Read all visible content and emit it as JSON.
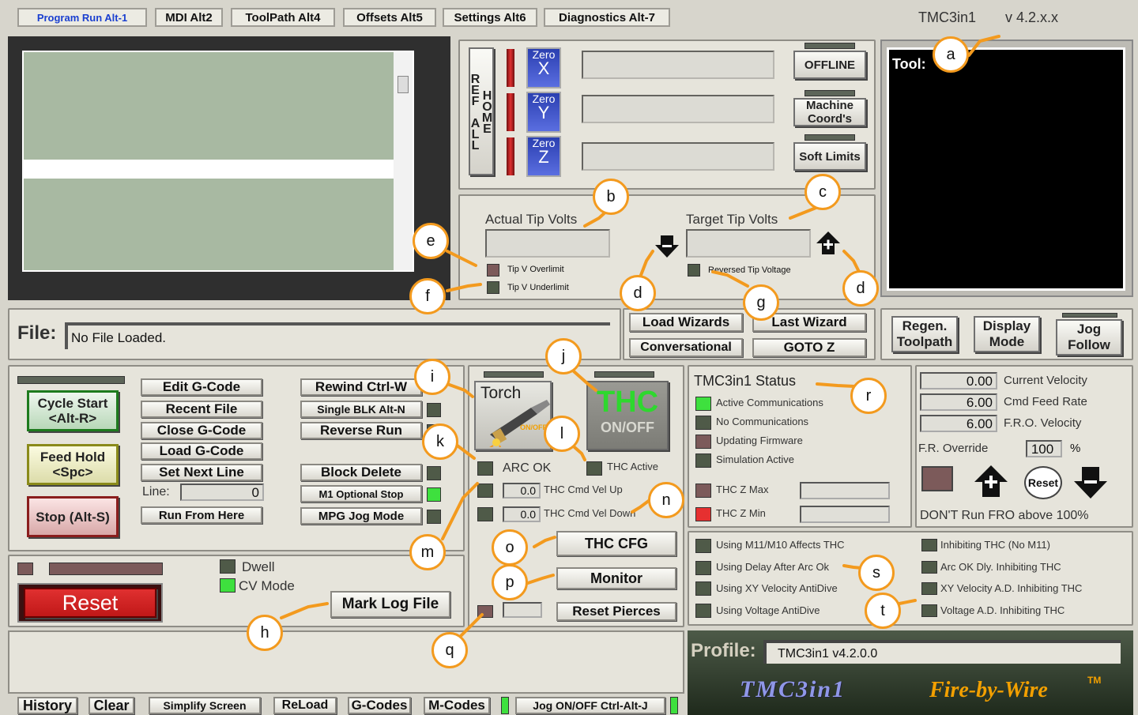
{
  "tabs": [
    "Program Run Alt-1",
    "MDI Alt2",
    "ToolPath Alt4",
    "Offsets Alt5",
    "Settings Alt6",
    "Diagnostics Alt-7"
  ],
  "header": {
    "app": "TMC3in1",
    "version": "v 4.2.x.x"
  },
  "dro": {
    "ref_all_home": "REF ALL HOME",
    "zero_label": "Zero",
    "axes": [
      "X",
      "Y",
      "Z"
    ],
    "offline": "OFFLINE",
    "machine_coords": "Machine Coord's",
    "soft_limits": "Soft Limits"
  },
  "tool_label": "Tool:",
  "volts": {
    "actual": "Actual Tip Volts",
    "target": "Target Tip Volts",
    "overlimit": "Tip V Overlimit",
    "underlimit": "Tip V Underlimit",
    "reversed": "Reversed Tip Voltage"
  },
  "file": {
    "label": "File:",
    "value": "No File Loaded."
  },
  "wizards": {
    "load": "Load Wizards",
    "last": "Last Wizard",
    "conversational": "Conversational",
    "goto_z": "GOTO Z"
  },
  "view": {
    "regen": "Regen. Toolpath",
    "display": "Display Mode",
    "jog": "Jog Follow"
  },
  "run": {
    "cycle_start": "Cycle Start <Alt-R>",
    "feed_hold": "Feed Hold <Spc>",
    "stop": "Stop (Alt-S)",
    "edit": "Edit G-Code",
    "recent": "Recent File",
    "close": "Close G-Code",
    "load": "Load G-Code",
    "set_next": "Set Next Line",
    "line_label": "Line:",
    "line_value": "0",
    "run_from_here": "Run From Here",
    "rewind": "Rewind Ctrl-W",
    "single_blk": "Single BLK Alt-N",
    "reverse": "Reverse Run",
    "block_delete": "Block Delete",
    "m1_stop": "M1 Optional Stop",
    "mpg": "MPG Jog Mode"
  },
  "bottom_left": {
    "dwell": "Dwell",
    "cv_mode": "CV Mode",
    "reset": "Reset",
    "mark_log": "Mark Log File"
  },
  "thc": {
    "torch": "Torch",
    "torch_onoff": "ON/OFF",
    "thc": "THC",
    "thc_onoff": "ON/OFF",
    "arc_ok": "ARC OK",
    "thc_active": "THC Active",
    "vel_up_value": "0.0",
    "vel_up": "THC Cmd Vel Up",
    "vel_down_value": "0.0",
    "vel_down": "THC Cmd Vel Down",
    "cfg": "THC CFG",
    "monitor": "Monitor",
    "reset_pierces": "Reset Pierces"
  },
  "status": {
    "title": "TMC3in1 Status",
    "items": [
      "Active Communications",
      "No Communications",
      "Updating Firmware",
      "Simulation Active"
    ],
    "zmax": "THC Z Max",
    "zmin": "THC Z Min"
  },
  "feed": {
    "rows": [
      {
        "value": "0.00",
        "label": "Current Velocity"
      },
      {
        "value": "6.00",
        "label": "Cmd Feed Rate"
      },
      {
        "value": "6.00",
        "label": "F.R.O. Velocity"
      }
    ],
    "override_label": "F.R. Override",
    "override_value": "100",
    "pct": "%",
    "reset": "Reset",
    "warning": "DON'T Run FRO above 100%"
  },
  "antidive": {
    "left": [
      "Using M11/M10 Affects THC",
      "Using Delay After Arc Ok",
      "Using XY Velocity AntiDive",
      "Using Voltage AntiDive"
    ],
    "right": [
      "Inhibiting THC (No M11)",
      "Arc OK Dly. Inhibiting THC",
      "XY Velocity A.D. Inhibiting THC",
      "Voltage A.D. Inhibiting THC"
    ]
  },
  "profile": {
    "label": "Profile:",
    "value": "TMC3in1 v4.2.0.0",
    "brand": "TMC3in1",
    "tagline": "Fire-by-Wire",
    "tm": "TM"
  },
  "bottom_bar": {
    "history": "History",
    "clear": "Clear",
    "simplify": "Simplify Screen",
    "reload": "ReLoad",
    "gcodes": "G-Codes",
    "mcodes": "M-Codes",
    "jog": "Jog ON/OFF Ctrl-Alt-J"
  },
  "callouts": [
    "a",
    "b",
    "c",
    "d",
    "d",
    "e",
    "f",
    "g",
    "h",
    "i",
    "j",
    "k",
    "l",
    "m",
    "n",
    "o",
    "p",
    "q",
    "r",
    "s",
    "t"
  ],
  "colors": {
    "led_on": "#3ee03e",
    "led_red": "#e63030",
    "accent_orange": "#f39a1e",
    "tab_blue": "#1a3fd0"
  }
}
